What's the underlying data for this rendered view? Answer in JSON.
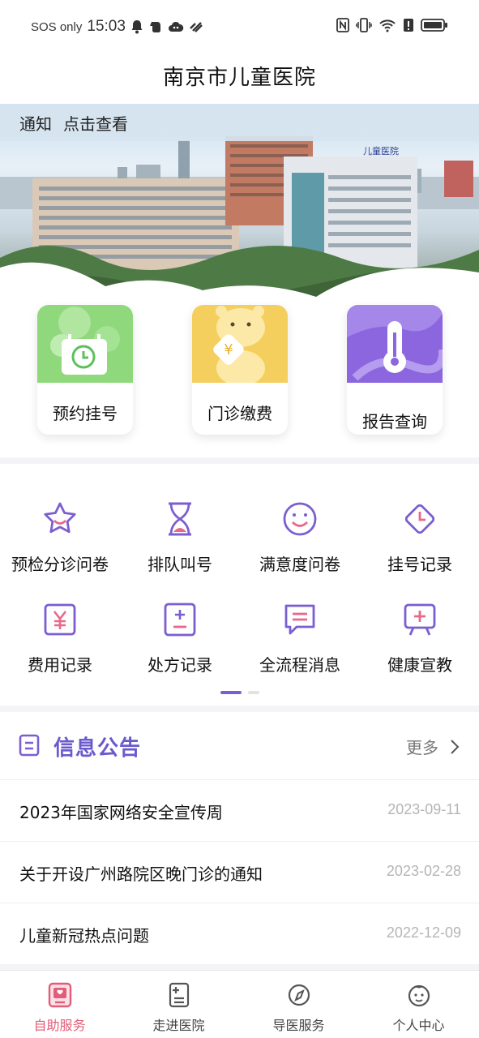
{
  "status_bar": {
    "carrier": "SOS only",
    "time": "15:03",
    "icons_left": [
      "bell-icon",
      "evernote-icon",
      "cloud-icon",
      "link-icon"
    ],
    "icons_right": [
      "nfc-icon",
      "vibrate-icon",
      "wifi-icon",
      "alert-icon",
      "battery-icon"
    ]
  },
  "header": {
    "title": "南京市儿童医院"
  },
  "banner": {
    "notice_label": "通知",
    "notice_action": "点击查看",
    "sign_text": "儿童医院"
  },
  "quick_tiles": [
    {
      "label": "预约挂号",
      "icon": "calendar-clock-icon",
      "color": "#8ed77a"
    },
    {
      "label": "门诊缴费",
      "icon": "yuan-bear-icon",
      "color": "#f5cf5e"
    },
    {
      "label": "报告查询",
      "icon": "thermometer-icon",
      "color": "#8c67df"
    }
  ],
  "services": [
    {
      "label": "预检分诊问卷",
      "icon": "star-icon"
    },
    {
      "label": "排队叫号",
      "icon": "hourglass-icon"
    },
    {
      "label": "满意度问卷",
      "icon": "smile-icon"
    },
    {
      "label": "挂号记录",
      "icon": "clock-diamond-icon"
    },
    {
      "label": "费用记录",
      "icon": "yuan-icon"
    },
    {
      "label": "处方记录",
      "icon": "prescription-icon"
    },
    {
      "label": "全流程消息",
      "icon": "message-icon"
    },
    {
      "label": "健康宣教",
      "icon": "health-board-icon"
    }
  ],
  "info": {
    "title": "信息公告",
    "more_label": "更多",
    "items": [
      {
        "title": "2023年国家网络安全宣传周",
        "date": "2023-09-11"
      },
      {
        "title": "关于开设广州路院区晚门诊的通知",
        "date": "2023-02-28"
      },
      {
        "title": "儿童新冠热点问题",
        "date": "2022-12-09"
      }
    ]
  },
  "bottom_nav": [
    {
      "label": "自助服务",
      "icon": "self-service-icon",
      "active": true
    },
    {
      "label": "走进医院",
      "icon": "hospital-doc-icon",
      "active": false
    },
    {
      "label": "导医服务",
      "icon": "compass-icon",
      "active": false
    },
    {
      "label": "个人中心",
      "icon": "baby-face-icon",
      "active": false
    }
  ],
  "colors": {
    "accent": "#7a5fd3",
    "active_nav": "#e25d77",
    "icon_purple": "#7b5ed0",
    "icon_pink": "#e8688a"
  }
}
